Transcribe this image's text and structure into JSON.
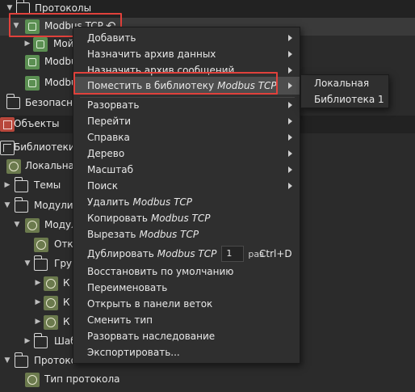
{
  "tree": {
    "rows": [
      {
        "label": "Протоколы"
      },
      {
        "label": "Modbus TCP"
      },
      {
        "label": "Мой"
      },
      {
        "label": "Modbu"
      },
      {
        "label": "Modbu"
      },
      {
        "label": "Безопасно"
      },
      {
        "label": "Объекты"
      },
      {
        "label": "Библиотеки"
      },
      {
        "label": "Локальная"
      },
      {
        "label": "Темы"
      },
      {
        "label": "Модули"
      },
      {
        "label": "Модул"
      },
      {
        "label": "Откл"
      },
      {
        "label": "Груп"
      },
      {
        "label": "К"
      },
      {
        "label": "К"
      },
      {
        "label": "К"
      },
      {
        "label": "Шаб"
      },
      {
        "label": "Протоколы"
      },
      {
        "label": "Тип протокола"
      }
    ],
    "back_icon": "undo-arrow-icon"
  },
  "context_menu": {
    "items": [
      {
        "label": "Добавить",
        "submenu": true
      },
      {
        "label": "Назначить архив данных",
        "submenu": true
      },
      {
        "label": "Назначить архив сообщений",
        "submenu": true
      },
      {
        "label": "Поместить в библиотеку",
        "italic": "Modbus TCP",
        "submenu": true,
        "highlighted": true
      },
      {
        "label": "Разорвать",
        "submenu": true
      },
      {
        "label": "Перейти",
        "submenu": true
      },
      {
        "label": "Справка",
        "submenu": true
      },
      {
        "label": "Дерево",
        "submenu": true
      },
      {
        "label": "Масштаб",
        "submenu": true
      },
      {
        "label": "Поиск",
        "submenu": true
      },
      {
        "label": "Удалить",
        "italic": "Modbus TCP"
      },
      {
        "label": "Копировать",
        "italic": "Modbus TCP"
      },
      {
        "label": "Вырезать",
        "italic": "Modbus TCP"
      },
      {
        "label": "Дублировать",
        "italic": "Modbus TCP",
        "spin_value": "1",
        "suffix": "раз",
        "hotkey": "Ctrl+D"
      },
      {
        "label": "Восстановить по умолчанию"
      },
      {
        "label": "Переименовать"
      },
      {
        "label": "Открыть в панели веток"
      },
      {
        "label": "Сменить тип"
      },
      {
        "label": "Разорвать наследование"
      },
      {
        "label": "Экспортировать..."
      }
    ]
  },
  "library_submenu": {
    "items": [
      {
        "label": "Локальная"
      },
      {
        "label": "Библиотека 1"
      }
    ]
  },
  "colors": {
    "background": "#2b2b2b",
    "menu_bg": "#2f2f2f",
    "highlight_border": "#e0413b",
    "node_green": "#5b8f52"
  }
}
